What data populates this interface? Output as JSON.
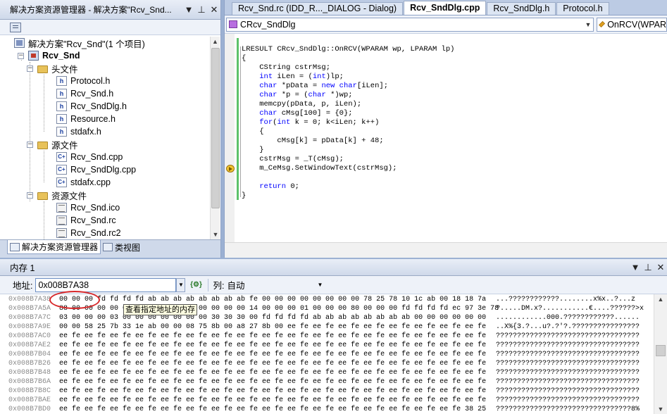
{
  "solution_explorer": {
    "title": "解决方案资源管理器 - 解决方案\"Rcv_Snd...",
    "tree": {
      "solution": "解决方案\"Rcv_Snd\"(1 个项目)",
      "project": "Rcv_Snd",
      "headers_folder": "头文件",
      "headers": [
        "Protocol.h",
        "Rcv_Snd.h",
        "Rcv_SndDlg.h",
        "Resource.h",
        "stdafx.h"
      ],
      "sources_folder": "源文件",
      "sources": [
        "Rcv_Snd.cpp",
        "Rcv_SndDlg.cpp",
        "stdafx.cpp"
      ],
      "resources_folder": "资源文件",
      "resources": [
        "Rcv_Snd.ico",
        "Rcv_Snd.rc",
        "Rcv_Snd.rc2"
      ]
    },
    "bottom_tabs": [
      "解决方案资源管理器",
      "类视图"
    ],
    "icons": {
      "pin": "pin-icon",
      "close": "close-icon",
      "dropdown": "dropdown-icon"
    }
  },
  "editor": {
    "tabs": [
      "Rcv_Snd.rc (IDD_R..._DIALOG - Dialog)",
      "Rcv_SndDlg.cpp",
      "Rcv_SndDlg.h",
      "Protocol.h"
    ],
    "active_tab": "Rcv_SndDlg.cpp",
    "class_combo": "CRcv_SndDlg",
    "member_combo": "OnRCV(WPAR",
    "code": [
      "LRESULT CRcv_SndDlg::OnRCV(WPARAM wp, LPARAM lp)",
      "{",
      "    CString cstrMsg;",
      "    int iLen = (int)lp;",
      "    char *pData = new char[iLen];",
      "    char *p = (char *)wp;",
      "    memcpy(pData, p, iLen);",
      "    char cMsg[100] = {0};",
      "    for(int k = 0; k<iLen; k++)",
      "    {",
      "        cMsg[k] = pData[k] + 48;",
      "    }",
      "    cstrMsg = _T(cMsg);",
      "    m_CeMsg.SetWindowText(cstrMsg);",
      "",
      "    return 0;",
      "}"
    ]
  },
  "memory": {
    "title": "内存 1",
    "address_label": "地址:",
    "address_value": "0x008B7A38",
    "columns_label": "列:",
    "columns_value": "自动",
    "tooltip": "查看指定地址的内存",
    "rows": [
      {
        "addr": "0x008B7A38",
        "bytes": "00 00 00 fd fd fd fd ab ab ab ab ab ab ab ab fe 00 00 00 00 00 00 00 00 78 25 78 10 1c ab 00 18 18 7a",
        "ascii": "...????????????........x%x..?...z"
      },
      {
        "addr": "0x008B7A5A",
        "bytes": "88 00 00 00 00 00 00 00 00 00 00 00 00 00 00 14 00 00 00 01 00 00 00 80 00 00 00 fd fd fd fd ec 97 3e 78",
        "ascii": "?.....DM.x?...........€....??????>x"
      },
      {
        "addr": "0x008B7A7C",
        "bytes": "03 00 00 00 03 00 00 00 00 00 00 00 30 30 30 00 fd fd fd fd ab ab ab ab ab ab ab ab 00 00 00 00 00 00",
        "ascii": "............000.????????????......"
      },
      {
        "addr": "0x008B7A9E",
        "bytes": "00 00 58 25 7b 33 1e ab 00 00 08 75 8b 00 a8 27 8b 00 ee fe ee fe ee fe ee fe ee fe ee fe ee fe ee fe",
        "ascii": "..X%{3.?...u?.?'?.????????????????"
      },
      {
        "addr": "0x008B7AC0",
        "bytes": "ee fe ee fe ee fe ee fe ee fe ee fe ee fe ee fe ee fe ee fe ee fe ee fe ee fe ee fe ee fe ee fe ee fe",
        "ascii": "??????????????????????????????????"
      },
      {
        "addr": "0x008B7AE2",
        "bytes": "ee fe ee fe ee fe ee fe ee fe ee fe ee fe ee fe ee fe ee fe ee fe ee fe ee fe ee fe ee fe ee fe ee fe",
        "ascii": "??????????????????????????????????"
      },
      {
        "addr": "0x008B7B04",
        "bytes": "ee fe ee fe ee fe ee fe ee fe ee fe ee fe ee fe ee fe ee fe ee fe ee fe ee fe ee fe ee fe ee fe ee fe",
        "ascii": "??????????????????????????????????"
      },
      {
        "addr": "0x008B7B26",
        "bytes": "ee fe ee fe ee fe ee fe ee fe ee fe ee fe ee fe ee fe ee fe ee fe ee fe ee fe ee fe ee fe ee fe ee fe",
        "ascii": "??????????????????????????????????"
      },
      {
        "addr": "0x008B7B48",
        "bytes": "ee fe ee fe ee fe ee fe ee fe ee fe ee fe ee fe ee fe ee fe ee fe ee fe ee fe ee fe ee fe ee fe ee fe",
        "ascii": "??????????????????????????????????"
      },
      {
        "addr": "0x008B7B6A",
        "bytes": "ee fe ee fe ee fe ee fe ee fe ee fe ee fe ee fe ee fe ee fe ee fe ee fe ee fe ee fe ee fe ee fe ee fe",
        "ascii": "??????????????????????????????????"
      },
      {
        "addr": "0x008B7B8C",
        "bytes": "ee fe ee fe ee fe ee fe ee fe ee fe ee fe ee fe ee fe ee fe ee fe ee fe ee fe ee fe ee fe ee fe ee fe",
        "ascii": "??????????????????????????????????"
      },
      {
        "addr": "0x008B7BAE",
        "bytes": "ee fe ee fe ee fe ee fe ee fe ee fe ee fe ee fe ee fe ee fe ee fe ee fe ee fe ee fe ee fe ee fe ee fe",
        "ascii": "??????????????????????????????????"
      },
      {
        "addr": "0x008B7BD0",
        "bytes": "ee fe ee fe ee fe ee fe ee fe ee fe ee fe ee fe ee fe ee fe ee fe ee fe ee fe ee fe ee fe ee fe 38 25",
        "ascii": "????????????????????????????????8%"
      }
    ]
  }
}
